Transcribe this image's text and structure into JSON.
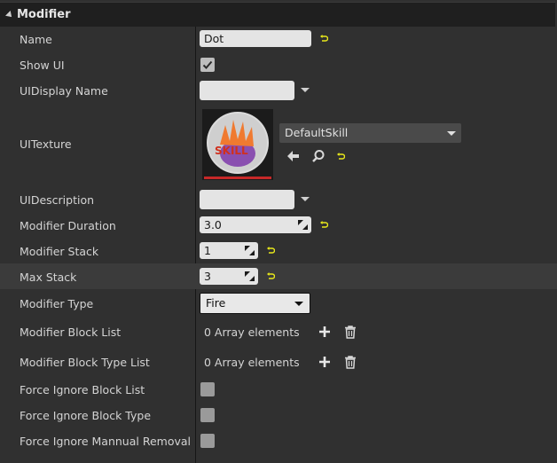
{
  "section": {
    "title": "Modifier"
  },
  "rows": {
    "name": {
      "label": "Name",
      "value": "Dot"
    },
    "show_ui": {
      "label": "Show UI",
      "checked": true
    },
    "ui_display_name": {
      "label": "UIDisplay Name",
      "value": ""
    },
    "ui_texture": {
      "label": "UITexture",
      "asset": "DefaultSkill",
      "thumbnail_text": "SKILL"
    },
    "ui_description": {
      "label": "UIDescription",
      "value": ""
    },
    "modifier_duration": {
      "label": "Modifier Duration",
      "value": "3.0"
    },
    "modifier_stack": {
      "label": "Modifier Stack",
      "value": "1"
    },
    "max_stack": {
      "label": "Max Stack",
      "value": "3"
    },
    "modifier_type": {
      "label": "Modifier Type",
      "value": "Fire"
    },
    "modifier_block_list": {
      "label": "Modifier Block List",
      "value": "0 Array elements"
    },
    "modifier_block_type_list": {
      "label": "Modifier Block Type List",
      "value": "0 Array elements"
    },
    "force_ignore_block_list": {
      "label": "Force Ignore Block List",
      "checked": false
    },
    "force_ignore_block_type": {
      "label": "Force Ignore Block Type",
      "checked": false
    },
    "force_ignore_manual_removal": {
      "label": "Force Ignore Mannual Removal",
      "checked": false
    }
  },
  "colors": {
    "reset_arrow": "#e8e81a",
    "highlight_row": "#3b3b3b",
    "panel_bg": "#303030"
  }
}
